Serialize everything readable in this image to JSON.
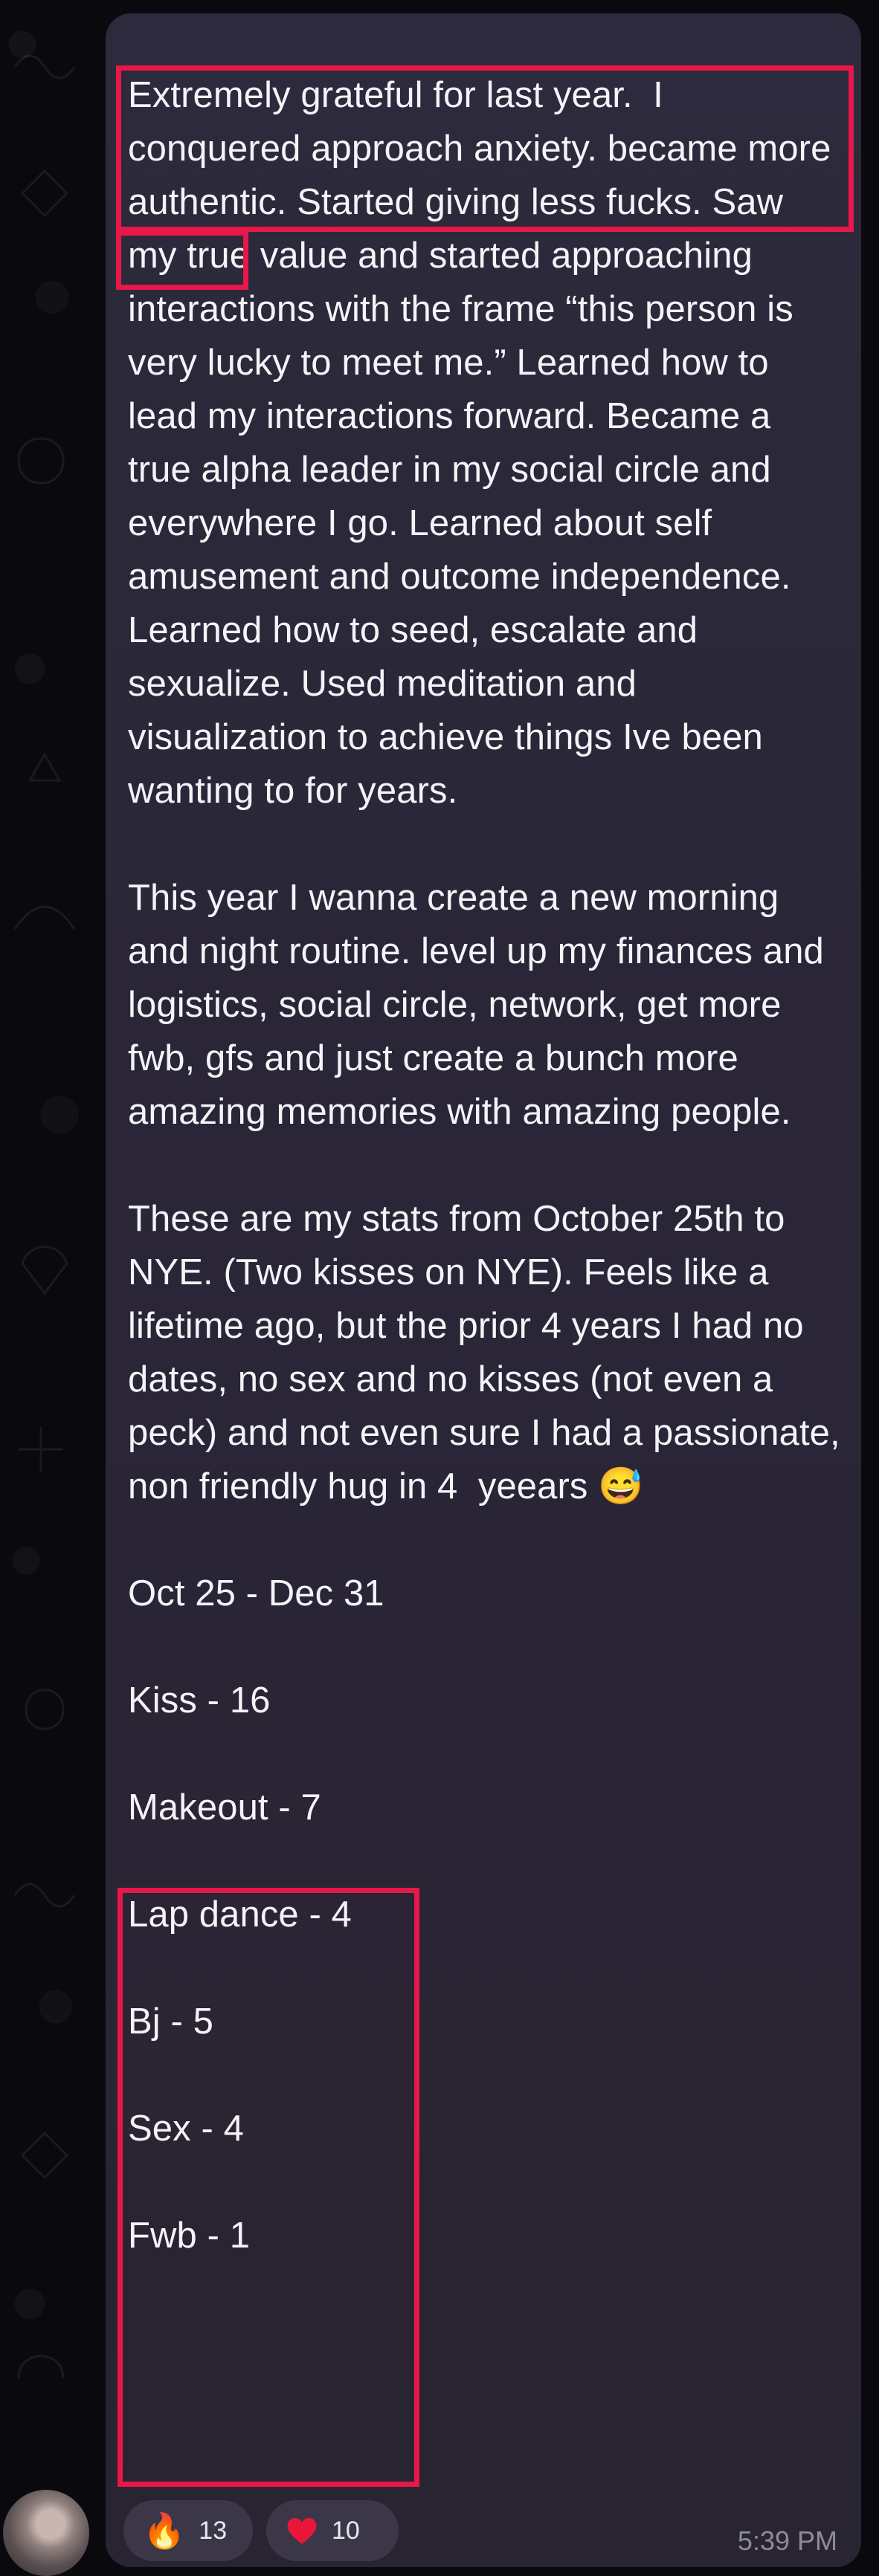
{
  "message": {
    "paragraphs": [
      "Extremely grateful for last year.  I conquered approach anxiety. became more authentic. Started giving less fucks. Saw my true value and started approaching interactions with the frame “this person is very lucky to meet me.” Learned how to lead my interactions forward. Became a true alpha leader in my social circle and everywhere I go. Learned about self amusement and outcome independence. Learned how to seed, escalate and sexualize. Used meditation and visualization to achieve things Ive been wanting to for years.",
      "This year I wanna create a new morning and night routine. level up my finances and logistics, social circle, network, get more fwb, gfs and just create a bunch more amazing memories with amazing people.",
      "These are my stats from October 25th to NYE. (Two kisses on NYE). Feels like a lifetime ago, but the prior 4 years I had no dates, no sex and no kisses (not even a peck) and not even sure I had a passionate, non friendly hug in 4  yeears 😅"
    ],
    "date_range": "Oct 25 - Dec 31",
    "stats": [
      "Kiss - 16",
      "Makeout - 7",
      "Lap dance - 4",
      "Bj - 5",
      "Sex - 4",
      "Fwb - 1"
    ],
    "timestamp": "5:39 PM"
  },
  "reactions": [
    {
      "emoji": "🔥",
      "icon": "fire-icon",
      "count": "13"
    },
    {
      "emoji": "❤️",
      "icon": "heart-icon",
      "count": "10"
    }
  ],
  "colors": {
    "highlight": "#e8174a",
    "bubble": "#2a2738",
    "text": "#f4f3f7",
    "timestamp": "#8e8a9c"
  }
}
